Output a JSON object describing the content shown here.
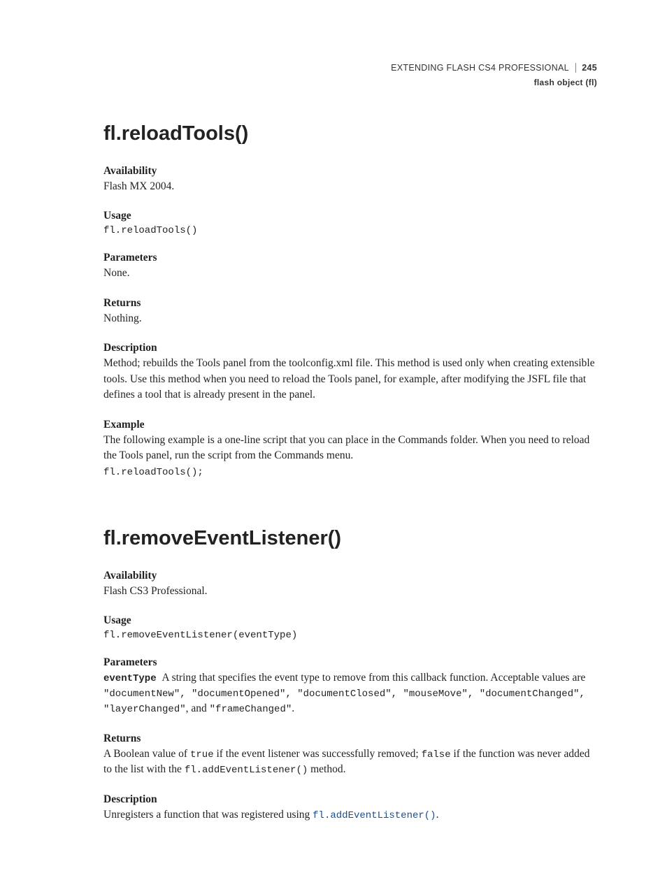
{
  "header": {
    "book_title": "EXTENDING FLASH CS4 PROFESSIONAL",
    "page_number": "245",
    "section": "flash object (fl)"
  },
  "sections": [
    {
      "title": "fl.reloadTools()",
      "blocks": [
        {
          "heading": "Availability",
          "body": [
            "Flash MX 2004."
          ]
        },
        {
          "heading": "Usage",
          "code": [
            "fl.reloadTools()"
          ]
        },
        {
          "heading": "Parameters",
          "body": [
            "None."
          ]
        },
        {
          "heading": "Returns",
          "body": [
            "Nothing."
          ]
        },
        {
          "heading": "Description",
          "body": [
            "Method; rebuilds the Tools panel from the toolconfig.xml file. This method is used only when creating extensible tools. Use this method when you need to reload the Tools panel, for example, after modifying the JSFL file that defines a tool that is already present in the panel."
          ]
        },
        {
          "heading": "Example",
          "body": [
            "The following example is a one-line script that you can place in the Commands folder. When you need to reload the Tools panel, run the script from the Commands menu."
          ],
          "code": [
            "fl.reloadTools();"
          ]
        }
      ]
    },
    {
      "title": "fl.removeEventListener()",
      "blocks": [
        {
          "heading": "Availability",
          "body": [
            "Flash CS3 Professional."
          ]
        },
        {
          "heading": "Usage",
          "code": [
            "fl.removeEventListener(eventType)"
          ]
        },
        {
          "heading": "Parameters",
          "param_name": "eventType",
          "param_intro": "A string that specifies the event type to remove from this callback function. Acceptable values are",
          "code": [
            "\"documentNew\", \"documentOpened\", \"documentClosed\", \"mouseMove\", \"documentChanged\","
          ],
          "param_tail_code1": "\"layerChanged\"",
          "param_tail_mid": ", and ",
          "param_tail_code2": "\"frameChanged\"",
          "param_tail_end": "."
        },
        {
          "heading": "Returns",
          "returns_pre": "A Boolean value of ",
          "returns_true": "true",
          "returns_mid": " if the event listener was successfully removed; ",
          "returns_false": "false",
          "returns_post1": " if the function was never added to the list with the ",
          "returns_method": "fl.addEventListener()",
          "returns_post2": " method."
        },
        {
          "heading": "Description",
          "desc_pre": "Unregisters a function that was registered using ",
          "desc_link": "fl.addEventListener()",
          "desc_post": "."
        }
      ]
    }
  ]
}
